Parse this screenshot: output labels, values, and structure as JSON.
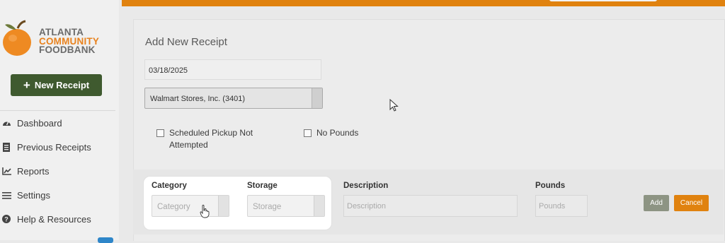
{
  "brand": {
    "line1": "ATLANTA",
    "line2": "COMMUNITY",
    "line3": "FOODBANK",
    "accent_color": "#e8821e",
    "logo_icon": "orange-fruit-icon"
  },
  "sidebar": {
    "new_receipt_label": "New Receipt",
    "new_receipt_icon": "plus-icon",
    "items": [
      {
        "label": "Dashboard",
        "icon": "gauge-icon"
      },
      {
        "label": "Previous Receipts",
        "icon": "document-icon"
      },
      {
        "label": "Reports",
        "icon": "line-chart-icon"
      },
      {
        "label": "Settings",
        "icon": "sliders-icon"
      },
      {
        "label": "Help & Resources",
        "icon": "question-circle-icon"
      }
    ]
  },
  "form": {
    "heading": "Add New Receipt",
    "date_value": "03/18/2025",
    "vendor_value": "Walmart Stores, Inc. (3401)",
    "checkbox_pickup_label": "Scheduled Pickup Not Attempted",
    "checkbox_nopounds_label": "No Pounds",
    "checkbox_pickup_checked": false,
    "checkbox_nopounds_checked": false
  },
  "item_row": {
    "category_label": "Category",
    "category_placeholder": "Category",
    "storage_label": "Storage",
    "storage_placeholder": "Storage",
    "description_label": "Description",
    "description_placeholder": "Description",
    "pounds_label": "Pounds",
    "pounds_placeholder": "Pounds",
    "add_label": "Add",
    "cancel_label": "Cancel"
  },
  "colors": {
    "topbar": "#e0820f",
    "primary_button": "#3f5a2f",
    "cancel_button": "#e0820f",
    "add_button": "#8d9483"
  }
}
